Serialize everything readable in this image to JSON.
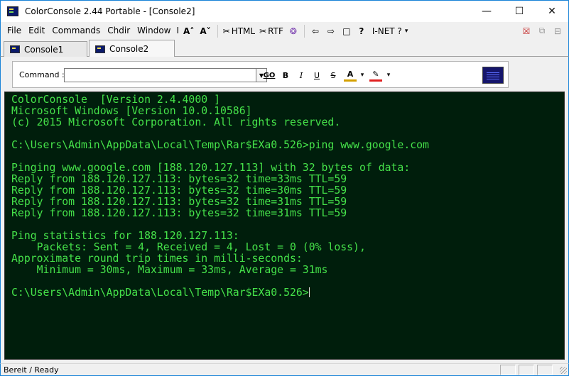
{
  "window": {
    "title": "ColorConsole 2.44  Portable - [Console2]",
    "minimize_glyph": "—",
    "maximize_glyph": "☐",
    "close_glyph": "✕"
  },
  "menu": {
    "items": [
      "File",
      "Edit",
      "Commands",
      "Chdir",
      "Window",
      "I"
    ]
  },
  "toolbar": {
    "html_label": "HTML",
    "rtf_label": "RTF",
    "inet_label": "I-NET ?",
    "font_larger_glyph": "A˄",
    "font_smaller_glyph": "A˅",
    "back_glyph": "⇦",
    "forward_glyph": "⇨",
    "new_glyph": "□",
    "help_glyph": "?",
    "dropdown_glyph": "▾",
    "html_glyph": "✂",
    "rtf_glyph": "✂",
    "palette_glyph": "❂"
  },
  "tabs": [
    {
      "label": "Console1",
      "active": false
    },
    {
      "label": "Console2",
      "active": true
    }
  ],
  "command_bar": {
    "label": "Command :",
    "value": "",
    "dropdown_glyph": "▼",
    "go_label": "GO",
    "bold_label": "B",
    "italic_label": "I",
    "underline_label": "U",
    "strike_label": "S",
    "font_color_label": "A",
    "font_color": "#d4a000",
    "highlight_color": "#e02020",
    "highlight_glyph": "✎",
    "format_dropdown_glyph": "▾"
  },
  "console": {
    "bg_color": "#001e0c",
    "text_color": "#45e24a",
    "lines": [
      "ColorConsole  [Version 2.4.4000 ]",
      "Microsoft Windows [Version 10.0.10586]",
      "(c) 2015 Microsoft Corporation. All rights reserved.",
      "",
      "C:\\Users\\Admin\\AppData\\Local\\Temp\\Rar$EXa0.526>ping www.google.com",
      "",
      "Pinging www.google.com [188.120.127.113] with 32 bytes of data:",
      "Reply from 188.120.127.113: bytes=32 time=33ms TTL=59",
      "Reply from 188.120.127.113: bytes=32 time=30ms TTL=59",
      "Reply from 188.120.127.113: bytes=32 time=31ms TTL=59",
      "Reply from 188.120.127.113: bytes=32 time=31ms TTL=59",
      "",
      "Ping statistics for 188.120.127.113:",
      "    Packets: Sent = 4, Received = 4, Lost = 0 (0% loss),",
      "Approximate round trip times in milli-seconds:",
      "    Minimum = 30ms, Maximum = 33ms, Average = 31ms",
      ""
    ],
    "prompt": "C:\\Users\\Admin\\AppData\\Local\\Temp\\Rar$EXa0.526>"
  },
  "status": {
    "text": "Bereit / Ready"
  }
}
